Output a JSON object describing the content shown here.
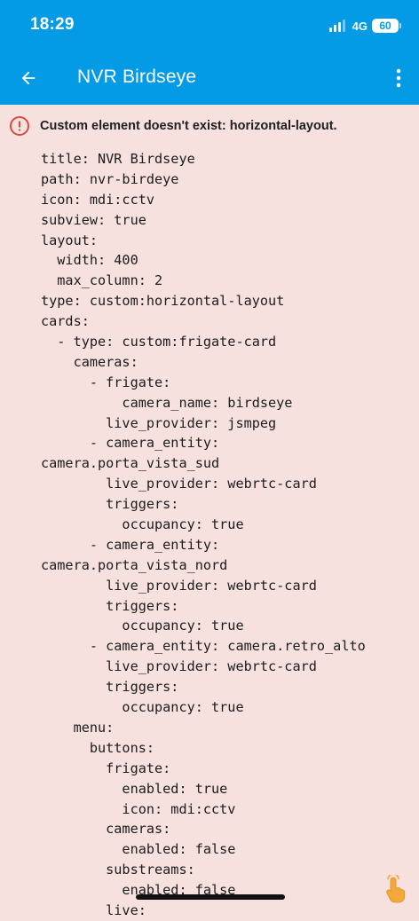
{
  "status_bar": {
    "time": "18:29",
    "network": "4G",
    "battery": "60"
  },
  "app_bar": {
    "title": "NVR Birdseye"
  },
  "error": {
    "message": "Custom element doesn't exist: horizontal-layout."
  },
  "yaml_lines": [
    "title: NVR Birdseye",
    "path: nvr-birdeye",
    "icon: mdi:cctv",
    "subview: true",
    "layout:",
    "  width: 400",
    "  max_column: 2",
    "type: custom:horizontal-layout",
    "cards:",
    "  - type: custom:frigate-card",
    "    cameras:",
    "      - frigate:",
    "          camera_name: birdseye",
    "        live_provider: jsmpeg",
    "      - camera_entity:",
    "camera.porta_vista_sud",
    "        live_provider: webrtc-card",
    "        triggers:",
    "          occupancy: true",
    "      - camera_entity:",
    "camera.porta_vista_nord",
    "        live_provider: webrtc-card",
    "        triggers:",
    "          occupancy: true",
    "      - camera_entity: camera.retro_alto",
    "        live_provider: webrtc-card",
    "        triggers:",
    "          occupancy: true",
    "    menu:",
    "      buttons:",
    "        frigate:",
    "          enabled: true",
    "          icon: mdi:cctv",
    "        cameras:",
    "          enabled: false",
    "        substreams:",
    "          enabled: false",
    "        live:"
  ],
  "colors": {
    "app_bar": "#039be5",
    "background": "#f6e1df",
    "error_icon": "#d84a3f",
    "text": "#1c1c1c"
  },
  "icons": {
    "back": "arrow-left-icon",
    "overflow": "dots-vertical-icon",
    "alert": "alert-circle-outline-icon",
    "signal": "cellular-signal-icon",
    "battery": "battery-icon",
    "touch": "touch-pointer-icon"
  }
}
